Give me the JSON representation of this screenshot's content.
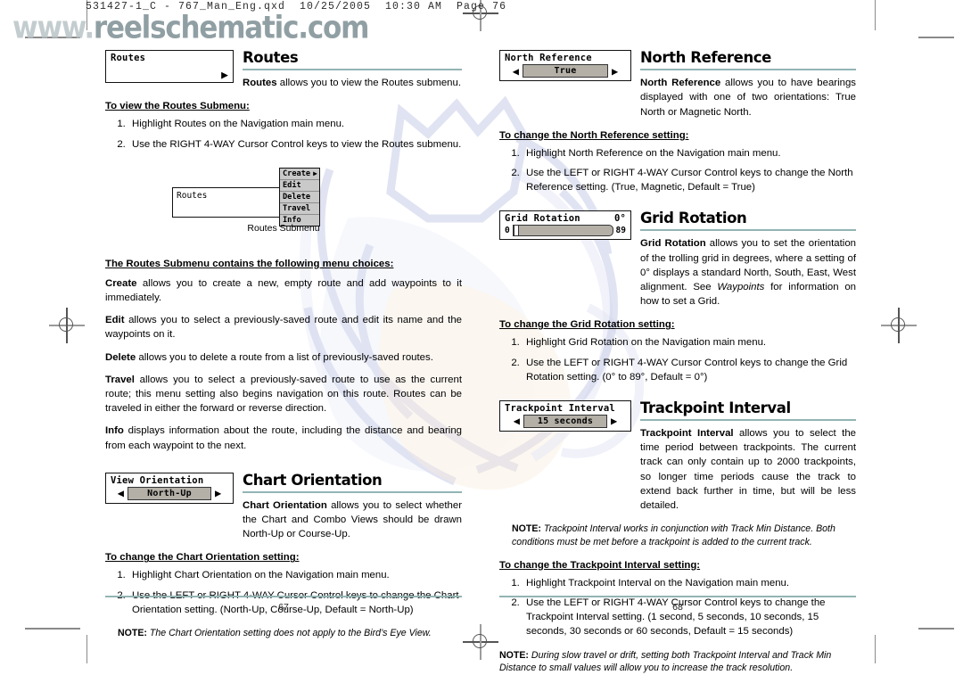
{
  "scan_header": "531427-1_C - 767_Man_Eng.qxd  10/25/2005  10:30 AM  Page 76",
  "watermark": {
    "www": "www.",
    "brand": "reelschematic.com"
  },
  "colors": {
    "rule": "#93b4b4",
    "lcd_value_bg": "#b4b0a8",
    "submenu_bg": "#c9c9c9",
    "wordmark": "#7d8f93"
  },
  "left_page": {
    "page_number": "67",
    "sections": [
      {
        "id": "routes",
        "heading": "Routes",
        "widget": {
          "type": "menu-arrow",
          "title": "Routes",
          "arrow": "▶"
        },
        "intro_bold": "Routes",
        "intro_rest": " allows you to view the Routes submenu.",
        "subhead": "To view the Routes Submenu:",
        "steps": [
          "Highlight Routes on the Navigation main menu.",
          "Use the RIGHT 4-WAY Cursor Control keys to view the Routes submenu."
        ]
      }
    ],
    "figure": {
      "main_label": "Routes",
      "submenu_items": [
        {
          "label": "Create",
          "arrow": "▶"
        },
        {
          "label": "Edit",
          "arrow": ""
        },
        {
          "label": "Delete",
          "arrow": ""
        },
        {
          "label": "Travel",
          "arrow": ""
        },
        {
          "label": "Info",
          "arrow": ""
        }
      ],
      "caption": "Routes Submenu"
    },
    "submenu_intro": "The Routes Submenu contains the following menu choices:",
    "choices": [
      {
        "term": "Create",
        "desc": " allows you to create a new, empty route and add waypoints to it immediately."
      },
      {
        "term": "Edit",
        "desc": " allows you to select a previously-saved route and edit its name and the waypoints on it."
      },
      {
        "term": "Delete",
        "desc": " allows you to delete a route from a list of previously-saved routes."
      },
      {
        "term": "Travel",
        "desc": " allows you to select a previously-saved route to use as the current route; this menu setting also begins navigation on this route. Routes can be traveled in either the forward or reverse direction."
      },
      {
        "term": "Info",
        "desc": " displays information about the route, including the distance and bearing from each waypoint to the next."
      }
    ],
    "chart_orientation": {
      "heading": "Chart Orientation",
      "widget": {
        "type": "left-right",
        "title": "View Orientation",
        "value": "North-Up",
        "left_arrow": "◀",
        "right_arrow": "▶"
      },
      "intro_bold": "Chart Orientation",
      "intro_rest": " allows you to select whether the Chart and Combo Views should be drawn North-Up or Course-Up.",
      "subhead": "To change the Chart Orientation setting:",
      "steps": [
        "Highlight Chart Orientation on the Navigation main menu.",
        "Use the LEFT or RIGHT 4-WAY Cursor Control keys to change the Chart Orientation setting. (North-Up, Course-Up, Default = North-Up)"
      ],
      "note_label": "NOTE:",
      "note_text": " The Chart Orientation setting does not apply to the Bird’s Eye View."
    }
  },
  "right_page": {
    "page_number": "68",
    "north_reference": {
      "heading": "North Reference",
      "widget": {
        "type": "left-right",
        "title": "North Reference",
        "value": "True",
        "left_arrow": "◀",
        "right_arrow": "▶"
      },
      "intro_bold": "North Reference",
      "intro_rest": " allows you to have bearings displayed with one of two orientations: True North or Magnetic North.",
      "subhead": "To change the North Reference setting:",
      "steps": [
        "Highlight North Reference on the Navigation main menu.",
        "Use the LEFT or RIGHT 4-WAY Cursor Control keys to change the North Reference setting. (True, Magnetic, Default = True)"
      ]
    },
    "grid_rotation": {
      "heading": "Grid Rotation",
      "widget": {
        "type": "slider",
        "title": "Grid Rotation",
        "current": "0°",
        "min_label": "0",
        "max_label": "89",
        "fill_percent": 0
      },
      "intro_bold": "Grid Rotation",
      "intro_rest": " allows you to set the orientation of the trolling grid in degrees, where a setting of 0° displays a standard North, South, East, West alignment. See ",
      "intro_italic": "Waypoints",
      "intro_tail": " for information on how to set a Grid.",
      "subhead": "To change the Grid Rotation setting:",
      "steps": [
        "Highlight Grid Rotation on the Navigation main menu.",
        "Use the LEFT or RIGHT 4-WAY Cursor Control keys to change the Grid Rotation setting. (0° to 89°, Default = 0°)"
      ]
    },
    "trackpoint_interval": {
      "heading": "Trackpoint Interval",
      "widget": {
        "type": "left-right",
        "title": "Trackpoint Interval",
        "value": "15 seconds",
        "left_arrow": "◀",
        "right_arrow": "▶"
      },
      "intro_bold": "Trackpoint Interval",
      "intro_rest": " allows you to select the time period between trackpoints.  The current track can only contain up to 2000 trackpoints, so longer time periods cause the track to extend back further in time, but will be less detailed.",
      "note1_label": "NOTE:",
      "note1_text": " Trackpoint Interval works in conjunction with Track Min Distance.  Both conditions must be met before a trackpoint is added to the current track.",
      "subhead": "To change the Trackpoint Interval setting:",
      "steps": [
        "Highlight Trackpoint Interval on the Navigation main menu.",
        "Use the LEFT or RIGHT 4-WAY Cursor Control keys to change the Trackpoint Interval setting. (1 second, 5 seconds, 10 seconds, 15 seconds, 30 seconds or 60 seconds, Default = 15 seconds)"
      ],
      "note2_label": "NOTE:",
      "note2_text": " During slow travel or drift, setting both Trackpoint Interval and Track Min Distance to small values will allow you to increase the track resolution."
    }
  }
}
